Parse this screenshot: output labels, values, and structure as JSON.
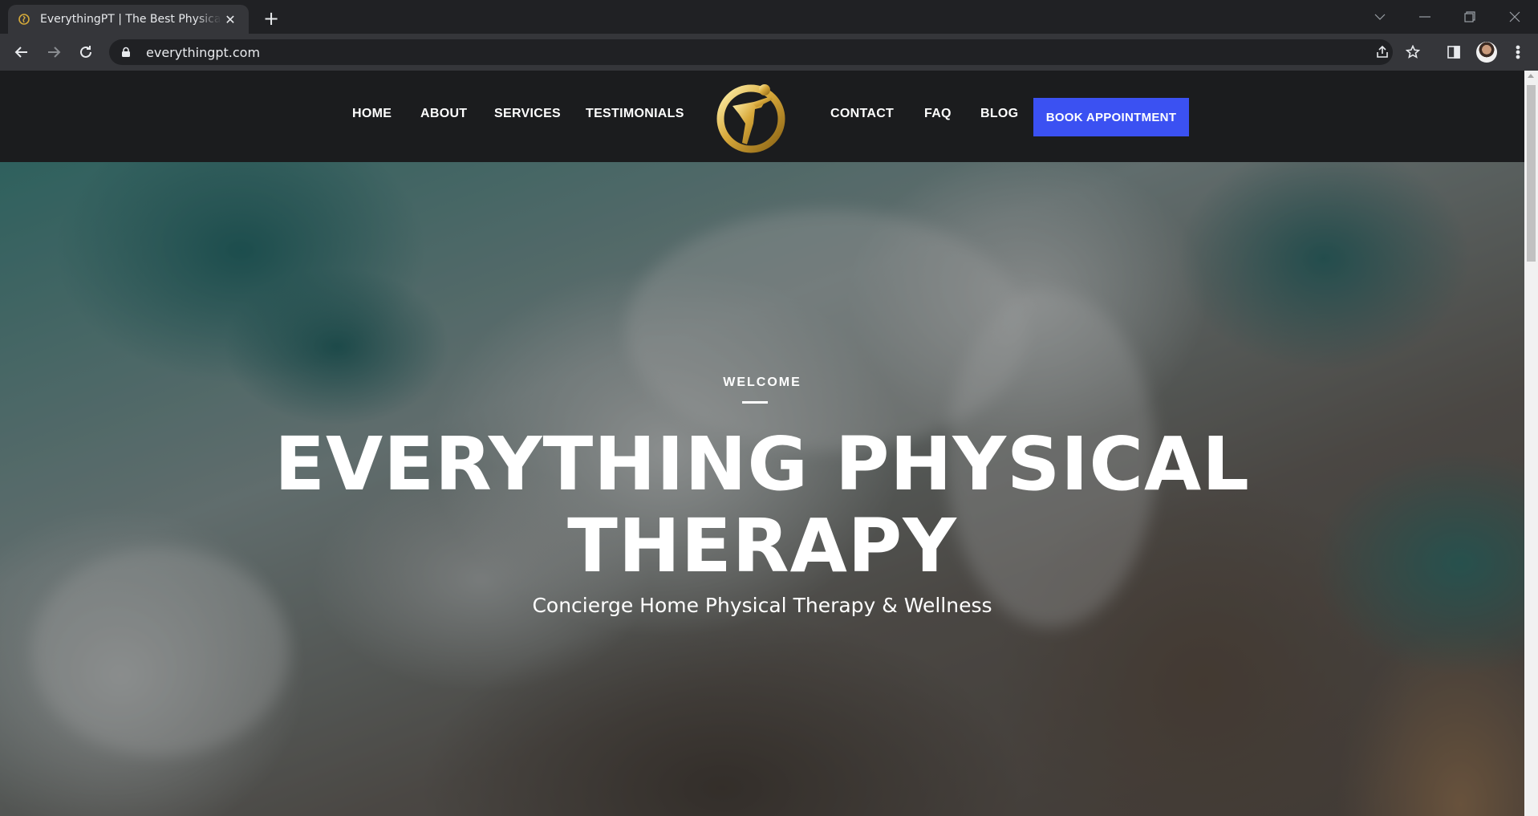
{
  "browser": {
    "tab_title": "EverythingPT | The Best Physical Therapy",
    "url": "everythingpt.com"
  },
  "nav": {
    "left_items": [
      "HOME",
      "ABOUT",
      "SERVICES",
      "TESTIMONIALS"
    ],
    "right_items": [
      "CONTACT",
      "FAQ",
      "BLOG"
    ],
    "cta_label": "BOOK APPOINTMENT",
    "cta_color": "#3b51f2",
    "header_bg": "#1b1c1e"
  },
  "hero": {
    "eyebrow": "WELCOME",
    "title_line1": "EVERYTHING PHYSICAL",
    "title_line2": "THERAPY",
    "subtitle": "Concierge Home Physical Therapy & Wellness"
  }
}
